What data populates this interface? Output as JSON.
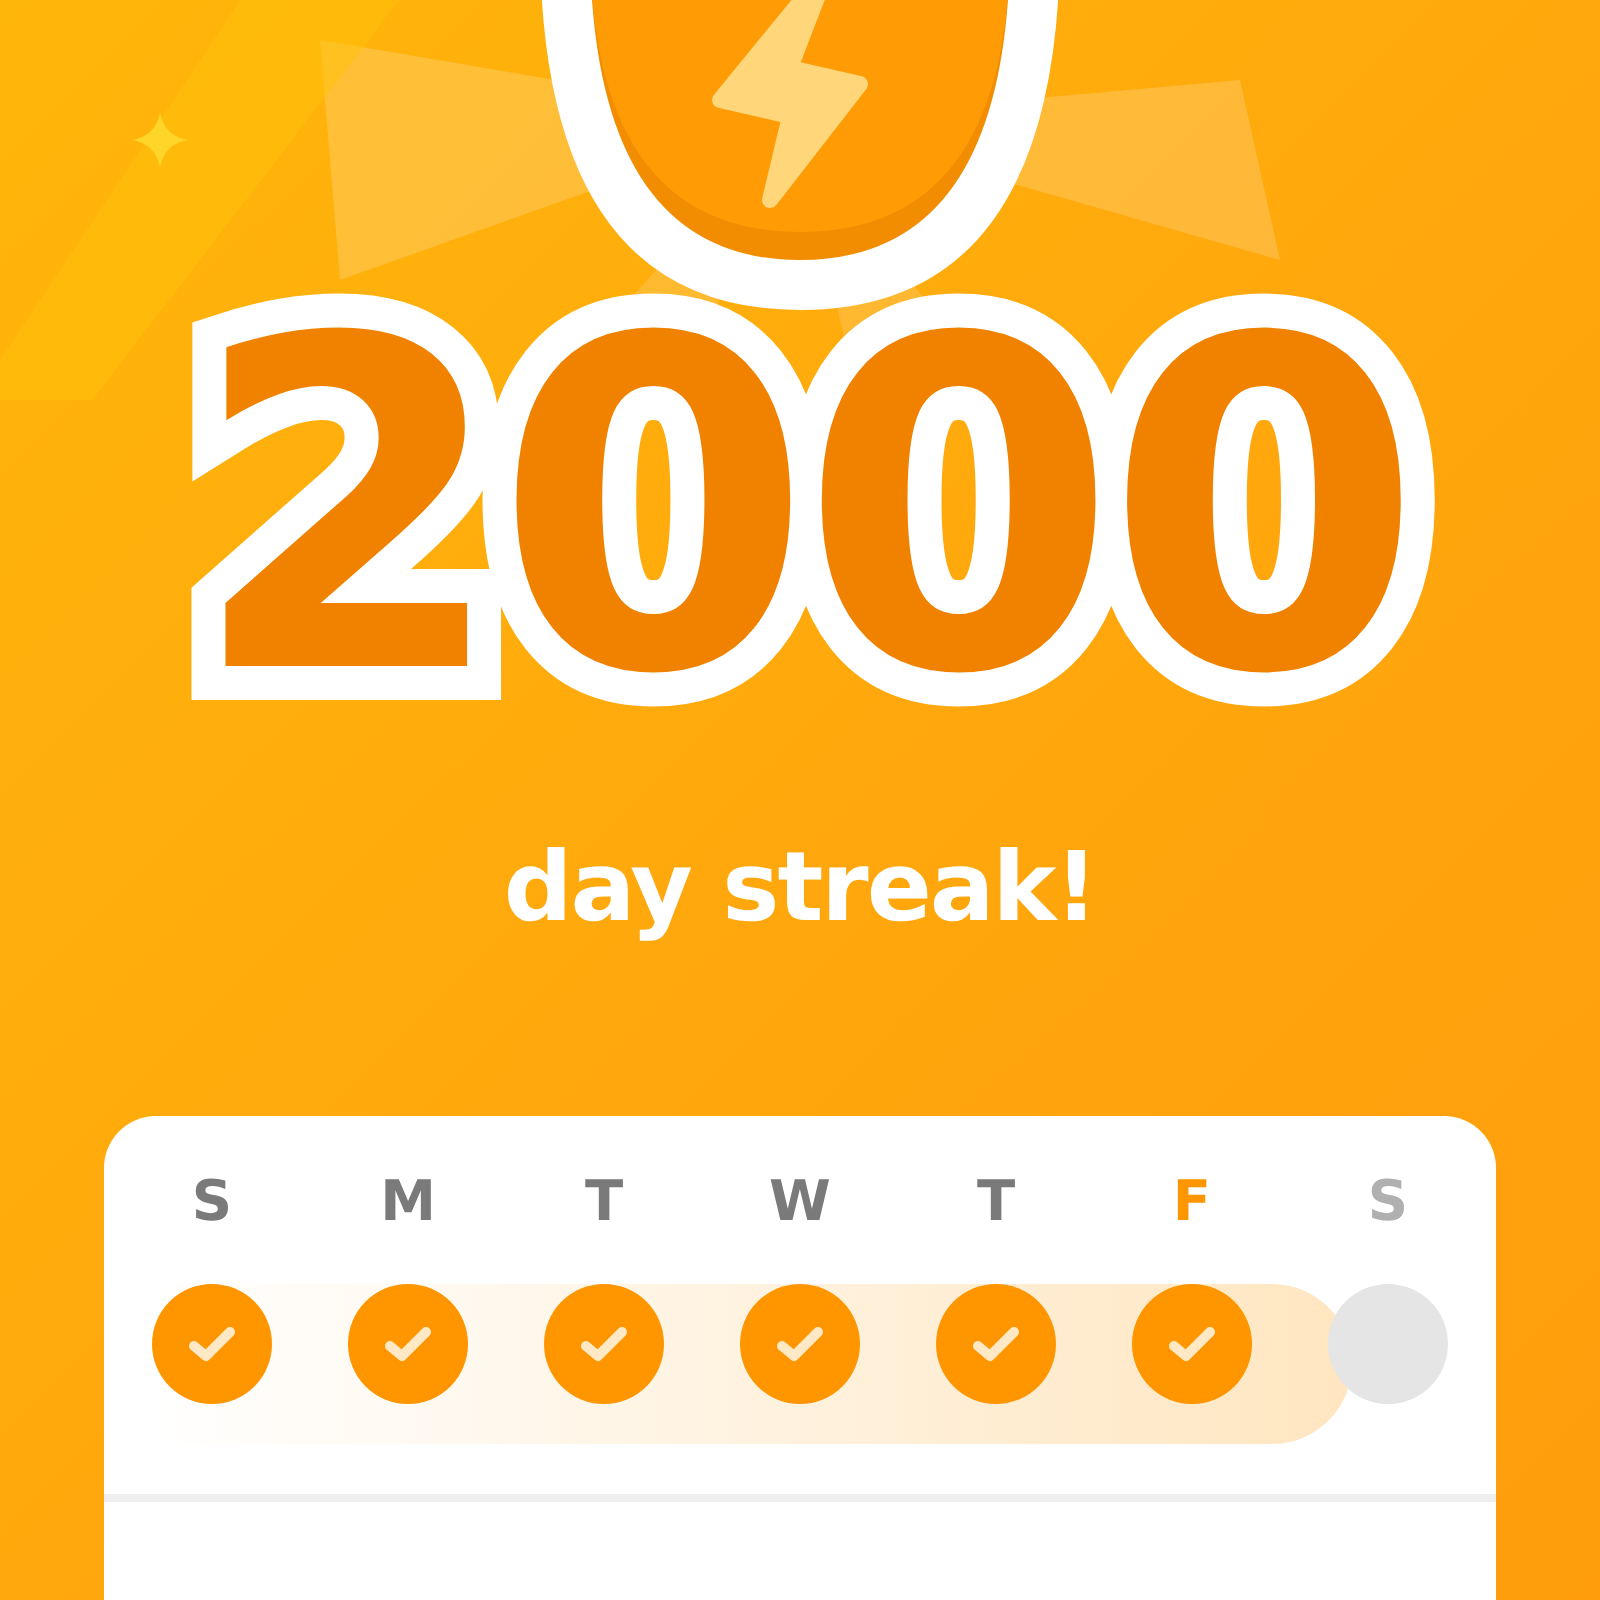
{
  "streak": {
    "count": "2000",
    "caption": "day streak!"
  },
  "week": [
    {
      "label": "S",
      "completed": true,
      "today": false
    },
    {
      "label": "M",
      "completed": true,
      "today": false
    },
    {
      "label": "T",
      "completed": true,
      "today": false
    },
    {
      "label": "W",
      "completed": true,
      "today": false
    },
    {
      "label": "T",
      "completed": true,
      "today": false
    },
    {
      "label": "F",
      "completed": true,
      "today": true
    },
    {
      "label": "S",
      "completed": false,
      "today": false
    }
  ]
}
